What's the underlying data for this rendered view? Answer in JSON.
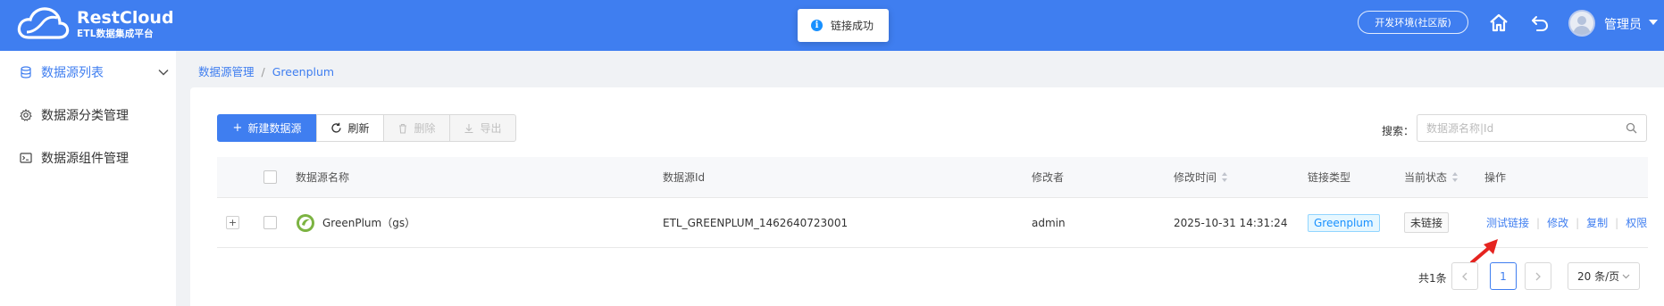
{
  "header": {
    "app_name": "RestCloud",
    "app_subtitle": "ETL数据集成平台",
    "env_label": "开发环境(社区版)",
    "user_name": "管理员",
    "brand_color": "#3f7ef0"
  },
  "toast": {
    "message": "链接成功",
    "icon": "info-icon"
  },
  "sidebar": {
    "items": [
      {
        "label": "数据源列表",
        "icon": "database-icon",
        "active": true
      },
      {
        "label": "数据源分类管理",
        "icon": "gear-icon",
        "active": false
      },
      {
        "label": "数据源组件管理",
        "icon": "terminal-icon",
        "active": false
      }
    ]
  },
  "breadcrumb": {
    "items": [
      "数据源管理",
      "Greenplum"
    ]
  },
  "toolbar": {
    "new_label": "新建数据源",
    "refresh_label": "刷新",
    "delete_label": "删除",
    "export_label": "导出"
  },
  "search": {
    "label": "搜索：",
    "placeholder": "数据源名称|Id"
  },
  "table": {
    "columns": [
      "数据源名称",
      "数据源Id",
      "修改者",
      "修改时间",
      "链接类型",
      "当前状态",
      "操作"
    ],
    "rows": [
      {
        "name": "GreenPlum（gs）",
        "id": "ETL_GREENPLUM_1462640723001",
        "modifier": "admin",
        "modified_time": "2025-10-31 14:31:24",
        "link_type": "Greenplum",
        "status": "未链接",
        "actions": [
          "测试链接",
          "修改",
          "复制",
          "权限"
        ]
      }
    ]
  },
  "pagination": {
    "total_label": "共1条",
    "current_page": "1",
    "page_size": "20 条/页"
  }
}
